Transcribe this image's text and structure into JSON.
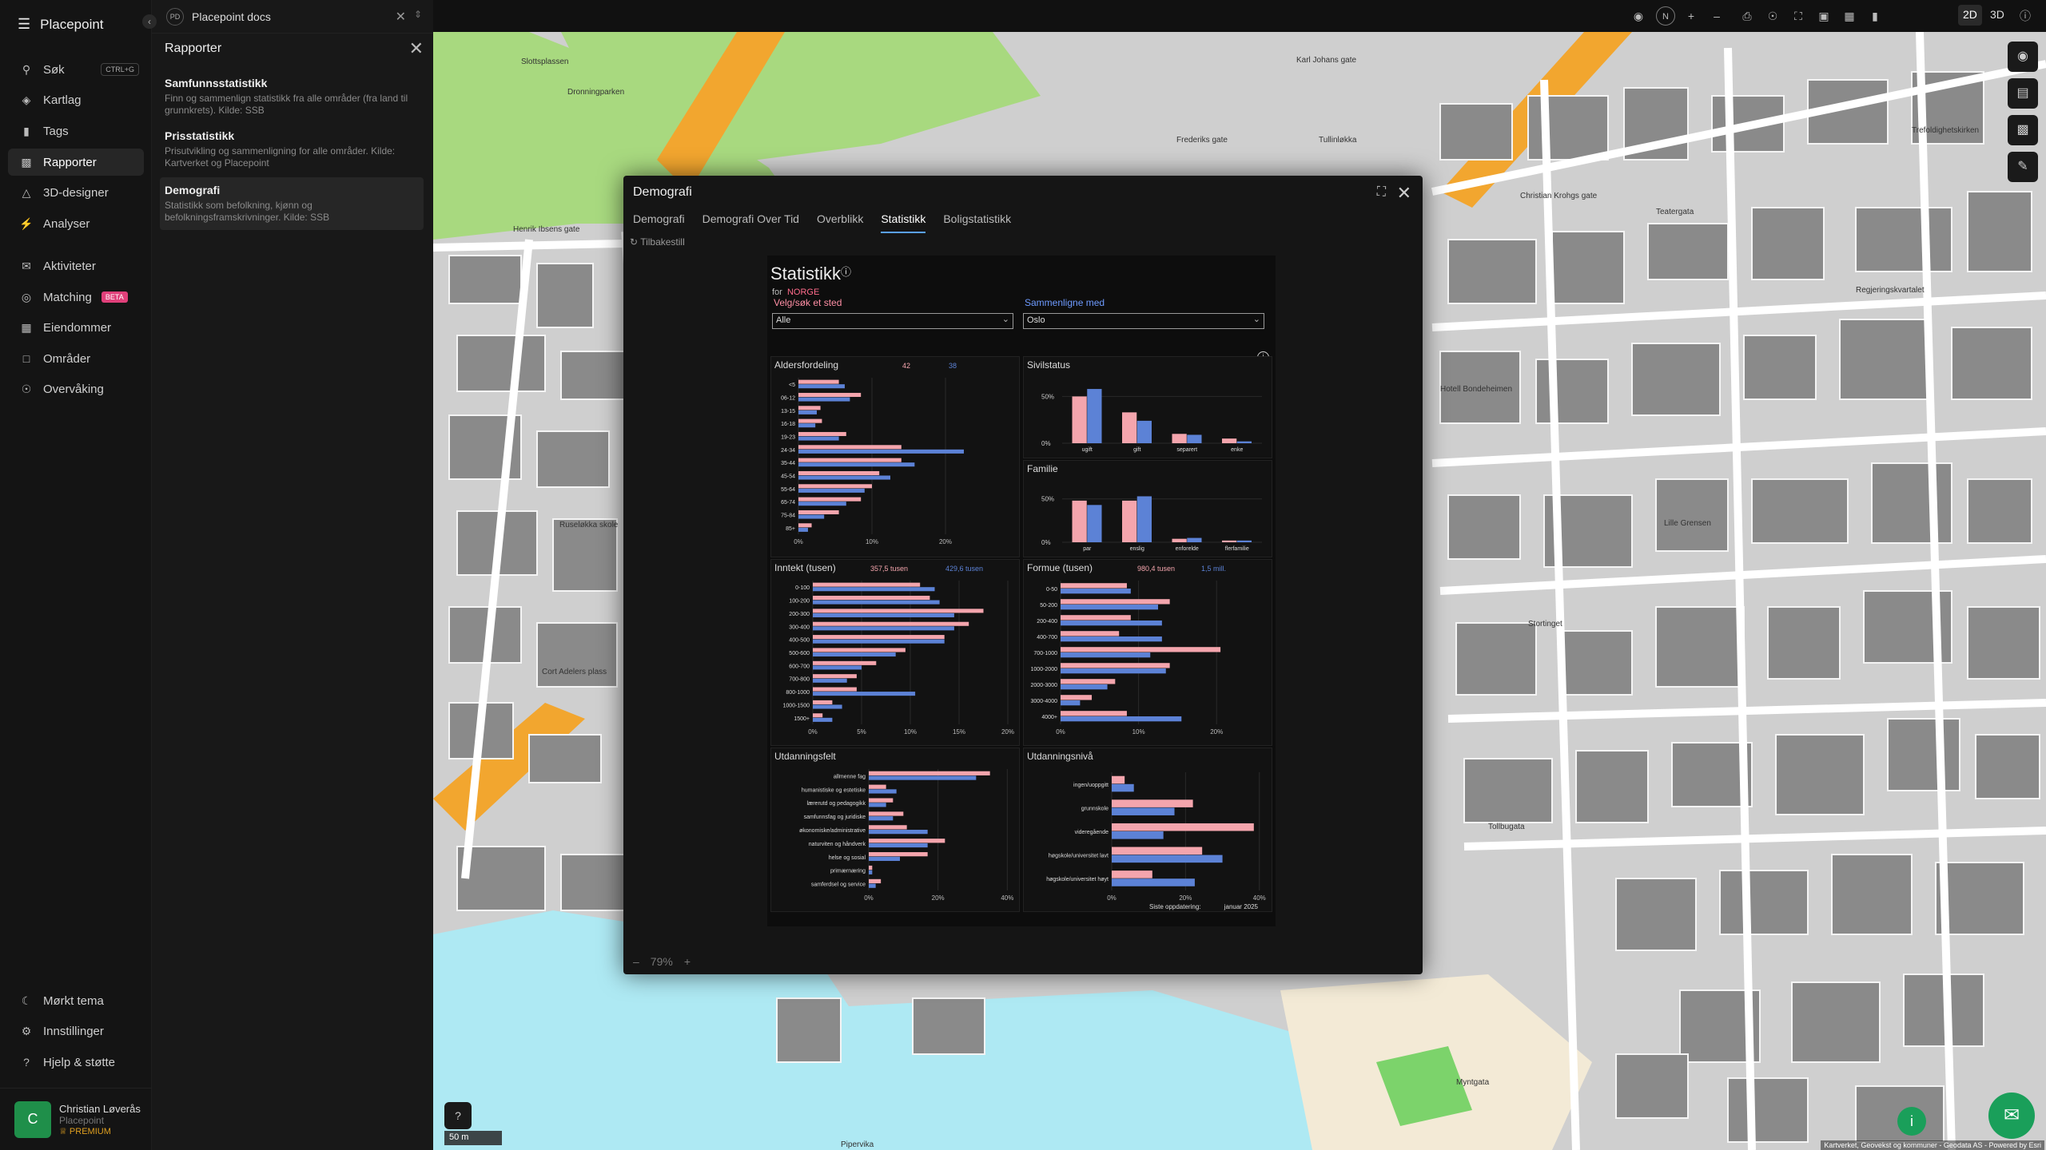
{
  "app": {
    "name": "Placepoint",
    "collapse_icon": "chevron-left-icon"
  },
  "nav": [
    {
      "label": "Søk",
      "icon": "search-icon",
      "shortcut": "CTRL+G"
    },
    {
      "label": "Kartlag",
      "icon": "layers-icon"
    },
    {
      "label": "Tags",
      "icon": "bookmark-icon"
    },
    {
      "label": "Rapporter",
      "icon": "chart-icon",
      "active": true
    },
    {
      "label": "3D-designer",
      "icon": "cube-icon"
    },
    {
      "label": "Analyser",
      "icon": "bolt-icon"
    },
    {
      "label": "Aktiviteter",
      "icon": "chat-icon"
    },
    {
      "label": "Matching",
      "icon": "target-icon",
      "badge": "BETA"
    },
    {
      "label": "Eiendommer",
      "icon": "building-icon"
    },
    {
      "label": "Områder",
      "icon": "area-icon"
    },
    {
      "label": "Overvåking",
      "icon": "eye-icon"
    }
  ],
  "footer_nav": [
    {
      "label": "Mørkt tema",
      "icon": "moon-icon"
    },
    {
      "label": "Innstillinger",
      "icon": "gear-icon"
    },
    {
      "label": "Hjelp & støtte",
      "icon": "help-icon"
    }
  ],
  "user": {
    "initial": "C",
    "name": "Christian Løverås",
    "org": "Placepoint",
    "plan": "PREMIUM"
  },
  "project_tab": {
    "badge": "PD",
    "title": "Placepoint docs"
  },
  "reports_panel": {
    "title": "Rapporter",
    "items": [
      {
        "title": "Samfunnsstatistikk",
        "desc": "Finn og sammenlign statistikk fra alle områder (fra land til grunnkrets). Kilde: SSB"
      },
      {
        "title": "Prisstatistikk",
        "desc": "Prisutvikling og sammenligning for alle områder. Kilde: Kartverket og Placepoint"
      },
      {
        "title": "Demografi",
        "desc": "Statistikk som befolkning, kjønn og befolkningsframskrivninger. Kilde: SSB",
        "selected": true
      }
    ]
  },
  "toolbar": {
    "view_2d": "2D",
    "view_3d": "3D",
    "compass": "N"
  },
  "modal": {
    "title": "Demografi",
    "tabs": [
      "Demografi",
      "Demografi Over Tid",
      "Overblikk",
      "Statistikk",
      "Boligstatistikk"
    ],
    "active_tab": 3,
    "reset_label": "Tilbakestill",
    "zoom": "79%"
  },
  "report": {
    "title": "Statistikk",
    "for_label": "for",
    "place": "NORGE",
    "select_label": "Velg/søk et sted",
    "compare_label": "Sammenligne med",
    "select_value": "Alle",
    "compare_value": "Oslo",
    "updated_label": "Siste oppdatering:",
    "updated_value": "januar 2025",
    "colors": {
      "primary": "#f4a5ad",
      "compare": "#5c82d6"
    }
  },
  "chart_data": [
    {
      "type": "bar",
      "orientation": "horizontal",
      "title": "Aldersfordeling",
      "legend_values": [
        "42",
        "38"
      ],
      "categories": [
        "<5",
        "06-12",
        "13-15",
        "16-18",
        "19-23",
        "24-34",
        "35-44",
        "45-54",
        "55-64",
        "65-74",
        "75-84",
        "85+"
      ],
      "series": [
        {
          "values": [
            5.5,
            8.5,
            3,
            3.2,
            6.5,
            14,
            14,
            11,
            10,
            8.5,
            5.5,
            1.8
          ]
        },
        {
          "values": [
            6.3,
            7,
            2.5,
            2.3,
            5.5,
            22.5,
            15.8,
            12.5,
            9,
            6.5,
            3.5,
            1.3
          ]
        }
      ],
      "ticks": [
        "0%",
        "10%",
        "20%"
      ],
      "xlim": [
        0,
        25
      ]
    },
    {
      "type": "bar",
      "title": "Sivilstatus",
      "categories": [
        "ugift",
        "gift",
        "separert",
        "enke"
      ],
      "series": [
        {
          "values": [
            50,
            33,
            10,
            5
          ]
        },
        {
          "values": [
            58,
            24,
            9,
            2
          ]
        }
      ],
      "ticks": [
        "50%",
        "0%"
      ],
      "ylim": [
        0,
        70
      ]
    },
    {
      "type": "bar",
      "title": "Familie",
      "categories": [
        "par",
        "enslig",
        "enforelde",
        "flerfamilie"
      ],
      "series": [
        {
          "values": [
            48,
            48,
            4,
            2
          ]
        },
        {
          "values": [
            43,
            53,
            5,
            2
          ]
        }
      ],
      "ticks": [
        "50%",
        "0%"
      ],
      "ylim": [
        0,
        70
      ]
    },
    {
      "type": "bar",
      "orientation": "horizontal",
      "title": "Inntekt (tusen)",
      "legend_values": [
        "357,5 tusen",
        "429,6 tusen"
      ],
      "categories": [
        "0-100",
        "100-200",
        "200-300",
        "300-400",
        "400-500",
        "500-600",
        "600-700",
        "700-800",
        "800-1000",
        "1000-1500",
        "1500+"
      ],
      "series": [
        {
          "values": [
            11,
            12,
            17.5,
            16,
            13.5,
            9.5,
            6.5,
            4.5,
            4.5,
            2,
            1
          ]
        },
        {
          "values": [
            12.5,
            13,
            14.5,
            14.5,
            13.5,
            8.5,
            5,
            3.5,
            10.5,
            3,
            2
          ]
        }
      ],
      "ticks": [
        "0%",
        "5%",
        "10%",
        "15%",
        "20%"
      ],
      "xlim": [
        0,
        20
      ]
    },
    {
      "type": "bar",
      "orientation": "horizontal",
      "title": "Formue (tusen)",
      "legend_values": [
        "980,4 tusen",
        "1,5 mill."
      ],
      "categories": [
        "0-50",
        "50-200",
        "200-400",
        "400-700",
        "700-1000",
        "1000-2000",
        "2000-3000",
        "3000-4000",
        "4000+"
      ],
      "series": [
        {
          "values": [
            8.5,
            14,
            9,
            7.5,
            20.5,
            14,
            7,
            4,
            8.5
          ]
        },
        {
          "values": [
            9,
            12.5,
            13,
            13,
            11.5,
            13.5,
            6,
            2.5,
            15.5
          ]
        }
      ],
      "ticks": [
        "0%",
        "10%",
        "20%"
      ],
      "xlim": [
        0,
        25
      ]
    },
    {
      "type": "bar",
      "orientation": "horizontal",
      "title": "Utdanningsfelt",
      "categories": [
        "allmenne fag",
        "humanistiske og estetiske",
        "lærerutd og pedagogikk",
        "samfunnsfag og juridiske",
        "økonomiske/administrative",
        "naturviten og håndverk",
        "helse og sosial",
        "primærnæring",
        "samferdsel og service"
      ],
      "series": [
        {
          "values": [
            35,
            5,
            7,
            10,
            11,
            22,
            17,
            1,
            3.5
          ]
        },
        {
          "values": [
            31,
            8,
            5,
            7,
            17,
            17,
            9,
            1,
            2
          ]
        }
      ],
      "ticks": [
        "0%",
        "20%",
        "40%"
      ],
      "xlim": [
        0,
        42
      ]
    },
    {
      "type": "bar",
      "orientation": "horizontal",
      "title": "Utdanningsnivå",
      "categories": [
        "ingen/uoppgitt",
        "grunnskole",
        "videregående",
        "høgskole/universitet lavt",
        "høgskole/universitet høyt"
      ],
      "series": [
        {
          "values": [
            3.5,
            22,
            38.5,
            24.5,
            11
          ]
        },
        {
          "values": [
            6,
            17,
            14,
            30,
            22.5
          ]
        }
      ],
      "ticks": [
        "0%",
        "20%",
        "40%"
      ],
      "xlim": [
        0,
        42
      ]
    }
  ],
  "map": {
    "streets": [
      "Slottsplassen",
      "Dronningparken",
      "Tullinløkka",
      "Regjeringskvartalet",
      "Henrik Ibsens gate",
      "Stortinget",
      "Ruseløkka skole",
      "Tollbugata",
      "Myntgata",
      "Pipervika",
      "Lille Grensen",
      "Teatergata",
      "Trefoldighetskirken",
      "Frederiks gate",
      "Karl Johans gate",
      "Christian Krohgs gate",
      "Cort Adelers plass",
      "Hotell Bondeheimen"
    ],
    "scale_label": "50 m",
    "attribution": "Kartverket, Geovekst og kommuner - Geodata AS - Powered by Esri"
  }
}
